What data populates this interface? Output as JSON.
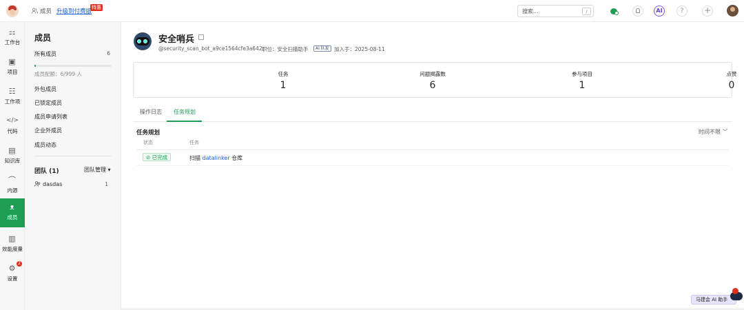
{
  "topbar": {
    "crumb": "成员",
    "upgrade": "升级到付费版",
    "hot_badge": "特惠",
    "search_placeholder": "搜索...",
    "search_shortcut": "/",
    "ai_label": "AI",
    "help_label": "?",
    "add_label": "+"
  },
  "rail": [
    {
      "label": "工作台",
      "icon": "⚏"
    },
    {
      "label": "项目",
      "icon": "▣"
    },
    {
      "label": "工作项",
      "icon": "☷"
    },
    {
      "label": "代码",
      "icon": "</>"
    },
    {
      "label": "知识库",
      "icon": "▤"
    },
    {
      "label": "内源",
      "icon": "⌒"
    },
    {
      "label": "成员",
      "icon": "ᴥ"
    },
    {
      "label": "效能度量",
      "icon": "▥"
    },
    {
      "label": "设置",
      "icon": "⚙",
      "badge": "2"
    }
  ],
  "sidebar": {
    "title": "成员",
    "all_members": "所有成员",
    "all_members_count": "6",
    "quota_fraction": 0.006,
    "quota_text": "成员配额：6/999 人",
    "items": [
      "外包成员",
      "已锁定成员",
      "成员申请列表",
      "企业外成员",
      "成员动态"
    ],
    "team_header": "团队 (1)",
    "team_manage": "团队管理 ▾",
    "team_name": "dasdas",
    "team_count": "1"
  },
  "profile": {
    "name": "安全哨兵",
    "handle": "@security_scan_bot_a9ce1564cfe3a642",
    "position": "职位：安全扫描助手",
    "ai_tag": "AI 队友",
    "joined": "加入于：2025-08-11"
  },
  "stats": [
    {
      "label": "任务",
      "value": "1"
    },
    {
      "label": "问题揭露数",
      "value": "6"
    },
    {
      "label": "参与项目",
      "value": "1"
    },
    {
      "label": "点赞",
      "value": "0"
    }
  ],
  "tabs": [
    "操作日志",
    "任务规划"
  ],
  "plan": {
    "title": "任务规划",
    "time_filter": "时间不限 ﹀",
    "col_status": "状态",
    "col_task": "任务",
    "row_status": "⊘ 已完成",
    "row_task_prefix": "扫描 ",
    "row_task_link": "datalinker",
    "row_task_suffix": " 仓库"
  },
  "assistant": {
    "label": "马建会 AI 助手"
  }
}
